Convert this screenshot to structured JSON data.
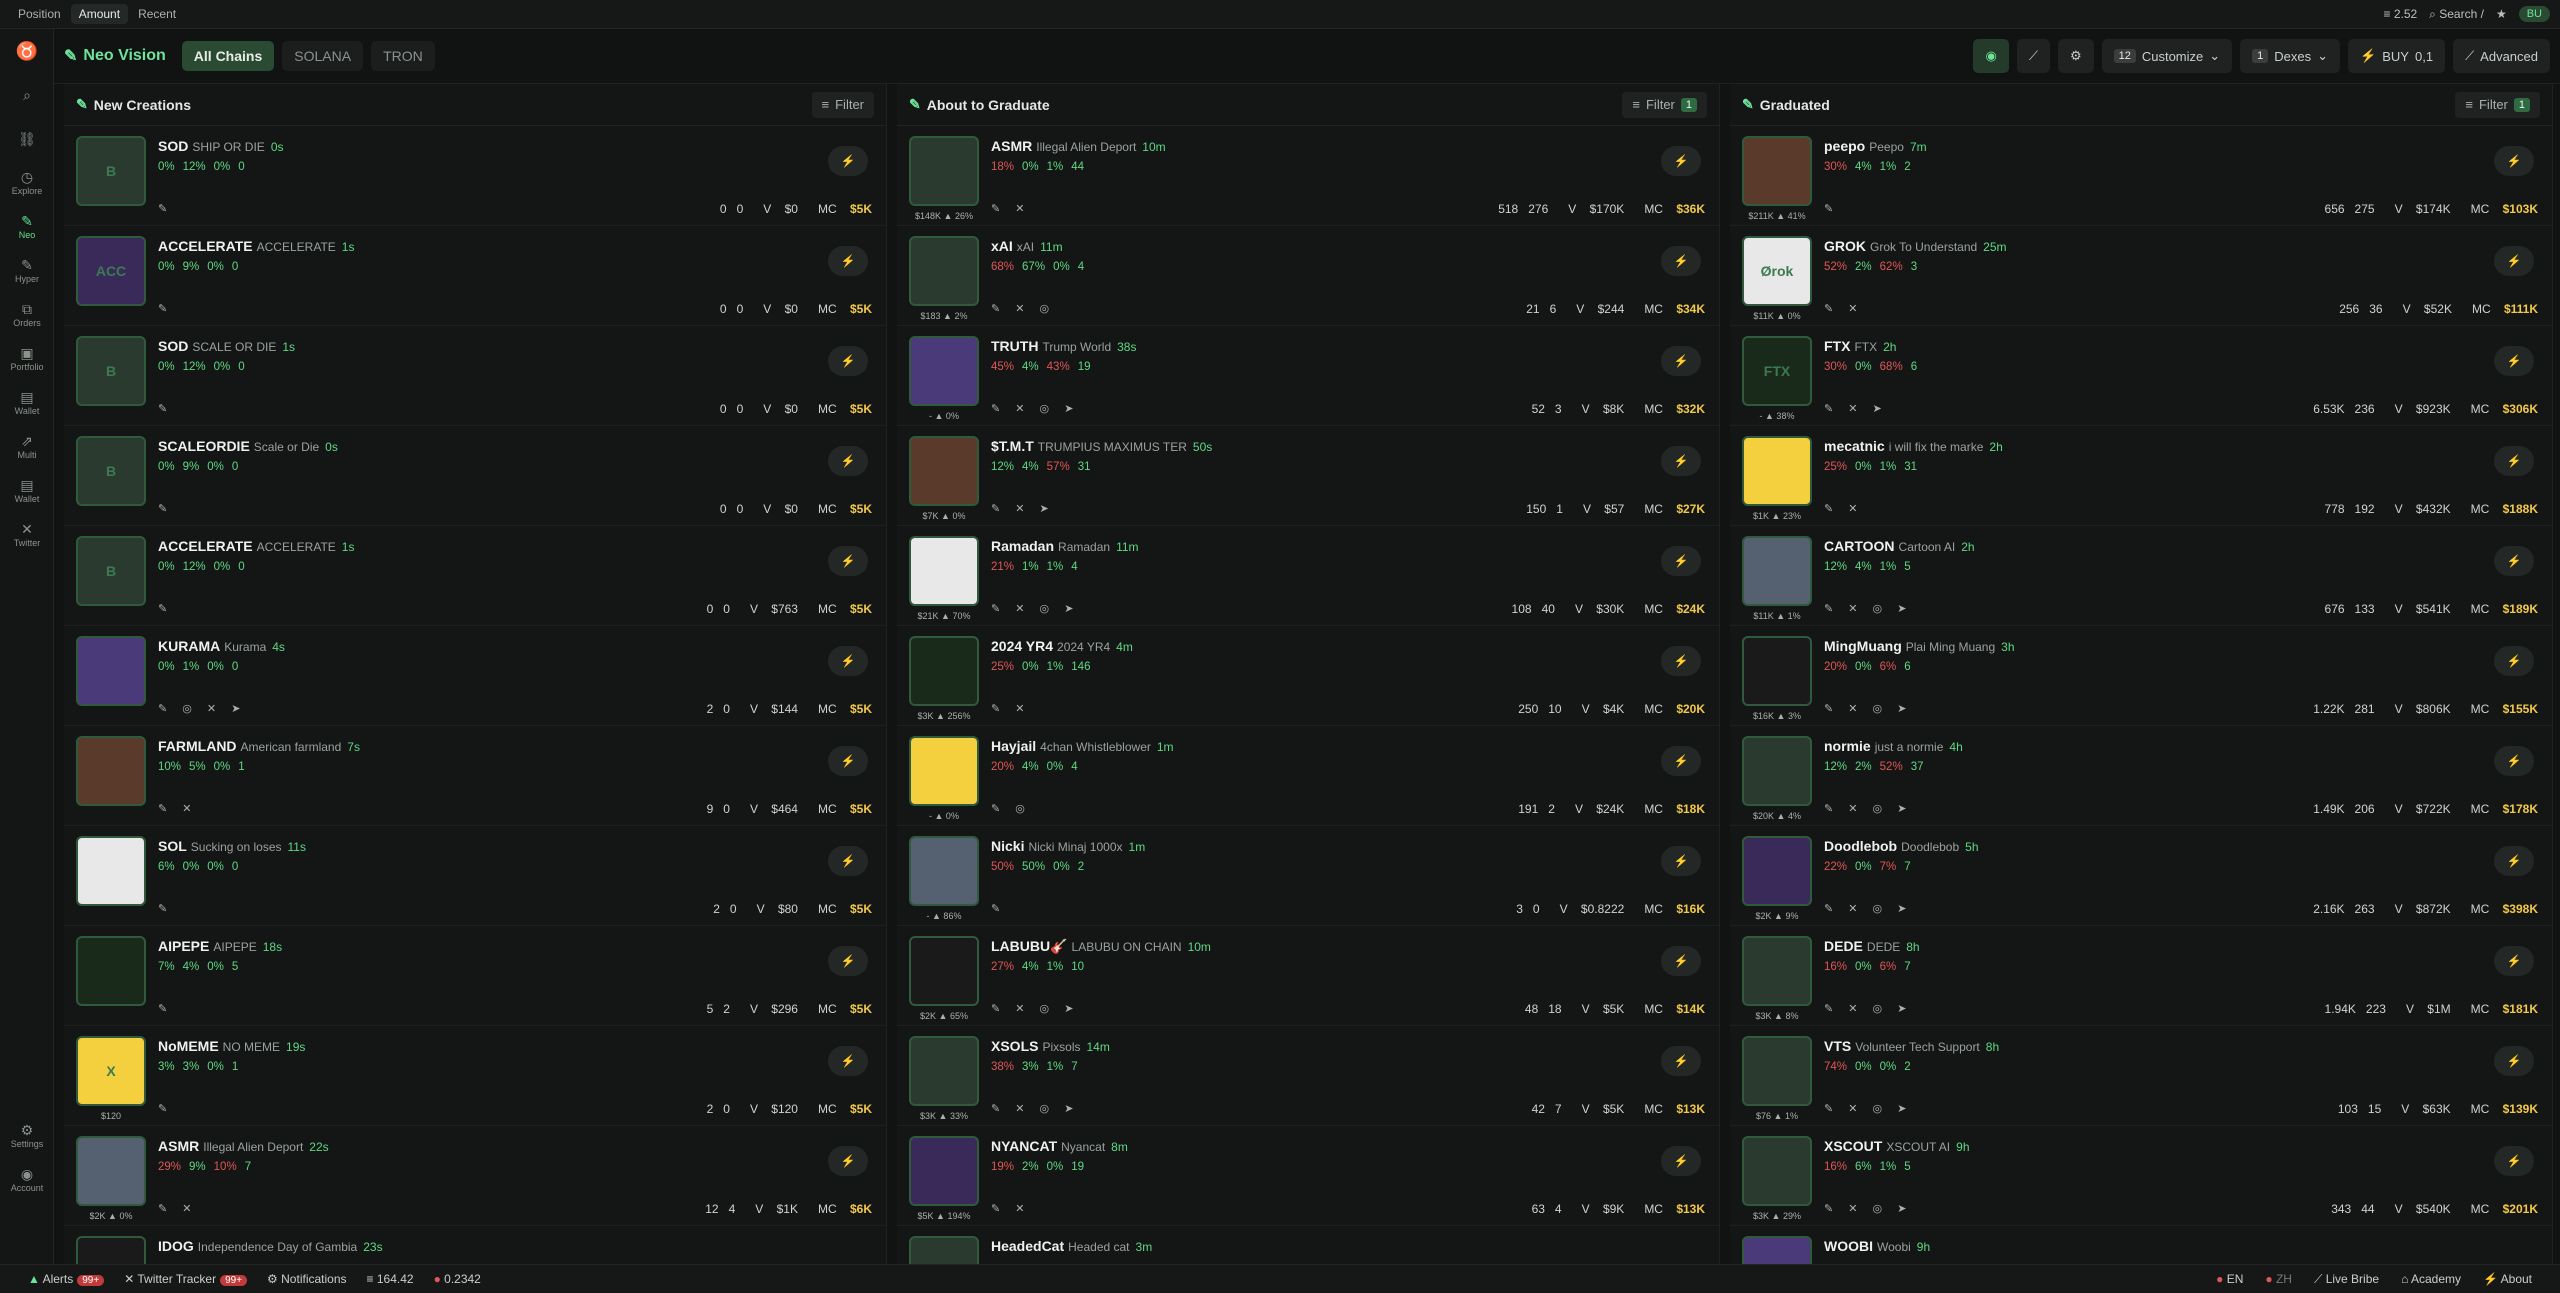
{
  "topbar": {
    "tabs": [
      "Position",
      "Amount",
      "Recent"
    ],
    "active": "Amount",
    "balance": "2.52",
    "search": "Search",
    "search_key": "/",
    "user": "BU"
  },
  "sidebar": [
    "Explore",
    "Neo",
    "Hyper",
    "Orders",
    "Portfolio",
    "Wallet",
    "Multi",
    "Wallet",
    "Twitter"
  ],
  "sidebar_bottom": [
    "Settings",
    "Account"
  ],
  "brand": "Neo Vision",
  "chains": [
    "All Chains",
    "SOLANA",
    "TRON"
  ],
  "header": {
    "customize_count": "12",
    "customize": "Customize",
    "dexes_count": "1",
    "dexes": "Dexes",
    "buy": "BUY",
    "buy_amount": "0,1",
    "advanced": "Advanced"
  },
  "columns": [
    {
      "title": "New Creations",
      "filter": "Filter",
      "filter_count": "",
      "rows": [
        {
          "sym": "SOD",
          "name": "SHIP OR DIE",
          "age": "0s",
          "s": [
            "0%",
            "12%",
            "0%",
            "0"
          ],
          "icons": "✎",
          "h": "0",
          "b": "0",
          "v": "$0",
          "mc": "$5K",
          "av": "B",
          "lbl": ""
        },
        {
          "sym": "ACCELERATE",
          "name": "ACCELERATE",
          "age": "1s",
          "s": [
            "0%",
            "9%",
            "0%",
            "0"
          ],
          "icons": "✎",
          "h": "0",
          "b": "0",
          "v": "$0",
          "mc": "$5K",
          "av": "ACC",
          "lbl": ""
        },
        {
          "sym": "SOD",
          "name": "SCALE OR DIE",
          "age": "1s",
          "s": [
            "0%",
            "12%",
            "0%",
            "0"
          ],
          "icons": "✎",
          "h": "0",
          "b": "0",
          "v": "$0",
          "mc": "$5K",
          "av": "B",
          "lbl": ""
        },
        {
          "sym": "SCALEORDIE",
          "name": "Scale or Die",
          "age": "0s",
          "s": [
            "0%",
            "9%",
            "0%",
            "0"
          ],
          "icons": "✎",
          "h": "0",
          "b": "0",
          "v": "$0",
          "mc": "$5K",
          "av": "B",
          "lbl": ""
        },
        {
          "sym": "ACCELERATE",
          "name": "ACCELERATE",
          "age": "1s",
          "s": [
            "0%",
            "12%",
            "0%",
            "0"
          ],
          "icons": "✎",
          "h": "0",
          "b": "0",
          "v": "$763",
          "mc": "$5K",
          "av": "B",
          "lbl": ""
        },
        {
          "sym": "KURAMA",
          "name": "Kurama",
          "age": "4s",
          "s": [
            "0%",
            "1%",
            "0%",
            "0"
          ],
          "icons": "✎ ◎ ✕ ➤",
          "h": "2",
          "b": "0",
          "v": "$144",
          "mc": "$5K",
          "av": "",
          "lbl": ""
        },
        {
          "sym": "FARMLAND",
          "name": "American farmland",
          "age": "7s",
          "s": [
            "10%",
            "5%",
            "0%",
            "1"
          ],
          "icons": "✎ ✕",
          "h": "9",
          "b": "0",
          "v": "$464",
          "mc": "$5K",
          "av": "",
          "lbl": ""
        },
        {
          "sym": "SOL",
          "name": "Sucking on loses",
          "age": "11s",
          "s": [
            "6%",
            "0%",
            "0%",
            "0"
          ],
          "icons": "✎",
          "h": "2",
          "b": "0",
          "v": "$80",
          "mc": "$5K",
          "av": "",
          "lbl": ""
        },
        {
          "sym": "AIPEPE",
          "name": "AIPEPE",
          "age": "18s",
          "s": [
            "7%",
            "4%",
            "0%",
            "5"
          ],
          "icons": "✎",
          "h": "5",
          "b": "2",
          "v": "$296",
          "mc": "$5K",
          "av": "",
          "lbl": ""
        },
        {
          "sym": "NoMEME",
          "name": "NO MEME",
          "age": "19s",
          "s": [
            "3%",
            "3%",
            "0%",
            "1"
          ],
          "icons": "✎",
          "h": "2",
          "b": "0",
          "v": "$120",
          "mc": "$5K",
          "av": "X",
          "lbl": "$120"
        },
        {
          "sym": "ASMR",
          "name": "Illegal Alien Deport",
          "age": "22s",
          "s": [
            "29%",
            "9%",
            "10%",
            "7"
          ],
          "icons": "✎ ✕",
          "h": "12",
          "b": "4",
          "v": "$1K",
          "mc": "$6K",
          "av": "",
          "lbl": "$2K ▲ 0%"
        },
        {
          "sym": "IDOG",
          "name": "Independence Day of Gambia",
          "age": "23s",
          "s": [
            "",
            "",
            "",
            ""
          ],
          "icons": "",
          "h": "",
          "b": "",
          "v": "",
          "mc": "",
          "av": "",
          "lbl": ""
        }
      ]
    },
    {
      "title": "About to Graduate",
      "filter": "Filter",
      "filter_count": "1",
      "rows": [
        {
          "sym": "ASMR",
          "name": "Illegal Alien Deport",
          "age": "10m",
          "s": [
            "18%",
            "0%",
            "1%",
            "44"
          ],
          "icons": "✎ ✕",
          "h": "518",
          "b": "276",
          "v": "$170K",
          "mc": "$36K",
          "av": "",
          "lbl": "$148K ▲ 26%"
        },
        {
          "sym": "xAI",
          "name": "xAI",
          "age": "11m",
          "s": [
            "68%",
            "67%",
            "0%",
            "4"
          ],
          "icons": "✎ ✕ ◎",
          "h": "21",
          "b": "6",
          "v": "$244",
          "mc": "$34K",
          "av": "",
          "lbl": "$183 ▲ 2%"
        },
        {
          "sym": "TRUTH",
          "name": "Trump World",
          "age": "38s",
          "s": [
            "45%",
            "4%",
            "43%",
            "19"
          ],
          "icons": "✎ ✕ ◎ ➤",
          "h": "52",
          "b": "3",
          "v": "$8K",
          "mc": "$32K",
          "av": "",
          "lbl": "- ▲ 0%"
        },
        {
          "sym": "$T.M.T",
          "name": "TRUMPIUS MAXIMUS TER",
          "age": "50s",
          "s": [
            "12%",
            "4%",
            "57%",
            "31"
          ],
          "icons": "✎ ✕ ➤",
          "h": "150",
          "b": "1",
          "v": "$57",
          "mc": "$27K",
          "av": "",
          "lbl": "$7K ▲ 0%"
        },
        {
          "sym": "Ramadan",
          "name": "Ramadan",
          "age": "11m",
          "s": [
            "21%",
            "1%",
            "1%",
            "4"
          ],
          "icons": "✎ ✕ ◎ ➤",
          "h": "108",
          "b": "40",
          "v": "$30K",
          "mc": "$24K",
          "av": "",
          "lbl": "$21K ▲ 70%"
        },
        {
          "sym": "2024 YR4",
          "name": "2024 YR4",
          "age": "4m",
          "s": [
            "25%",
            "0%",
            "1%",
            "146"
          ],
          "icons": "✎ ✕",
          "h": "250",
          "b": "10",
          "v": "$4K",
          "mc": "$20K",
          "av": "",
          "lbl": "$3K ▲ 256%"
        },
        {
          "sym": "Hayjail",
          "name": "4chan Whistleblower",
          "age": "1m",
          "s": [
            "20%",
            "4%",
            "0%",
            "4"
          ],
          "icons": "✎ ◎",
          "h": "191",
          "b": "2",
          "v": "$24K",
          "mc": "$18K",
          "av": "",
          "lbl": "- ▲ 0%"
        },
        {
          "sym": "Nicki",
          "name": "Nicki Minaj 1000x",
          "age": "1m",
          "s": [
            "50%",
            "50%",
            "0%",
            "2"
          ],
          "icons": "✎",
          "h": "3",
          "b": "0",
          "v": "$0.8222",
          "mc": "$16K",
          "av": "",
          "lbl": "- ▲ 86%"
        },
        {
          "sym": "LABUBU🎸",
          "name": "LABUBU ON CHAIN",
          "age": "10m",
          "s": [
            "27%",
            "4%",
            "1%",
            "10"
          ],
          "icons": "✎ ✕ ◎ ➤",
          "h": "48",
          "b": "18",
          "v": "$5K",
          "mc": "$14K",
          "av": "",
          "lbl": "$2K ▲ 65%"
        },
        {
          "sym": "XSOLS",
          "name": "Pixsols",
          "age": "14m",
          "s": [
            "38%",
            "3%",
            "1%",
            "7"
          ],
          "icons": "✎ ✕ ◎ ➤",
          "h": "42",
          "b": "7",
          "v": "$5K",
          "mc": "$13K",
          "av": "",
          "lbl": "$3K ▲ 33%"
        },
        {
          "sym": "NYANCAT",
          "name": "Nyancat",
          "age": "8m",
          "s": [
            "19%",
            "2%",
            "0%",
            "19"
          ],
          "icons": "✎ ✕",
          "h": "63",
          "b": "4",
          "v": "$9K",
          "mc": "$13K",
          "av": "",
          "lbl": "$5K ▲ 194%"
        },
        {
          "sym": "HeadedCat",
          "name": "Headed cat",
          "age": "3m",
          "s": [
            "",
            "",
            "",
            ""
          ],
          "icons": "",
          "h": "",
          "b": "",
          "v": "",
          "mc": "",
          "av": "",
          "lbl": ""
        }
      ]
    },
    {
      "title": "Graduated",
      "filter": "Filter",
      "filter_count": "1",
      "rows": [
        {
          "sym": "peepo",
          "name": "Peepo",
          "age": "7m",
          "s": [
            "30%",
            "4%",
            "1%",
            "2"
          ],
          "icons": "✎",
          "h": "656",
          "b": "275",
          "v": "$174K",
          "mc": "$103K",
          "av": "",
          "lbl": "$211K ▲ 41%"
        },
        {
          "sym": "GROK",
          "name": "Grok To Understand",
          "age": "25m",
          "s": [
            "52%",
            "2%",
            "62%",
            "3"
          ],
          "icons": "✎ ✕",
          "h": "256",
          "b": "36",
          "v": "$52K",
          "mc": "$111K",
          "av": "Ørok",
          "lbl": "$11K ▲ 0%"
        },
        {
          "sym": "FTX",
          "name": "FTX",
          "age": "2h",
          "s": [
            "30%",
            "0%",
            "68%",
            "6"
          ],
          "icons": "✎ ✕ ➤",
          "h": "6.53K",
          "b": "236",
          "v": "$923K",
          "mc": "$306K",
          "av": "FTX",
          "lbl": "- ▲ 38%"
        },
        {
          "sym": "mecatnic",
          "name": "i will fix the marke",
          "age": "2h",
          "s": [
            "25%",
            "0%",
            "1%",
            "31"
          ],
          "icons": "✎ ✕",
          "h": "778",
          "b": "192",
          "v": "$432K",
          "mc": "$188K",
          "av": "",
          "lbl": "$1K ▲ 23%"
        },
        {
          "sym": "CARTOON",
          "name": "Cartoon AI",
          "age": "2h",
          "s": [
            "12%",
            "4%",
            "1%",
            "5"
          ],
          "icons": "✎ ✕ ◎ ➤",
          "h": "676",
          "b": "133",
          "v": "$541K",
          "mc": "$189K",
          "av": "",
          "lbl": "$11K ▲ 1%"
        },
        {
          "sym": "MingMuang",
          "name": "Plai Ming Muang",
          "age": "3h",
          "s": [
            "20%",
            "0%",
            "6%",
            "6"
          ],
          "icons": "✎ ✕ ◎ ➤",
          "h": "1.22K",
          "b": "281",
          "v": "$806K",
          "mc": "$155K",
          "av": "",
          "lbl": "$16K ▲ 3%"
        },
        {
          "sym": "normie",
          "name": "just a normie",
          "age": "4h",
          "s": [
            "12%",
            "2%",
            "52%",
            "37"
          ],
          "icons": "✎ ✕ ◎ ➤",
          "h": "1.49K",
          "b": "206",
          "v": "$722K",
          "mc": "$178K",
          "av": "",
          "lbl": "$20K ▲ 4%"
        },
        {
          "sym": "Doodlebob",
          "name": "Doodlebob",
          "age": "5h",
          "s": [
            "22%",
            "0%",
            "7%",
            "7"
          ],
          "icons": "✎ ✕ ◎ ➤",
          "h": "2.16K",
          "b": "263",
          "v": "$872K",
          "mc": "$398K",
          "av": "",
          "lbl": "$2K ▲ 9%"
        },
        {
          "sym": "DEDE",
          "name": "DEDE",
          "age": "8h",
          "s": [
            "16%",
            "0%",
            "6%",
            "7"
          ],
          "icons": "✎ ✕ ◎ ➤",
          "h": "1.94K",
          "b": "223",
          "v": "$1M",
          "mc": "$181K",
          "av": "",
          "lbl": "$3K ▲ 8%"
        },
        {
          "sym": "VTS",
          "name": "Volunteer Tech Support",
          "age": "8h",
          "s": [
            "74%",
            "0%",
            "0%",
            "2"
          ],
          "icons": "✎ ✕ ◎ ➤",
          "h": "103",
          "b": "15",
          "v": "$63K",
          "mc": "$139K",
          "av": "",
          "lbl": "$76 ▲ 1%"
        },
        {
          "sym": "XSCOUT",
          "name": "XSCOUT AI",
          "age": "9h",
          "s": [
            "16%",
            "6%",
            "1%",
            "5"
          ],
          "icons": "✎ ✕ ◎ ➤",
          "h": "343",
          "b": "44",
          "v": "$540K",
          "mc": "$201K",
          "av": "",
          "lbl": "$3K ▲ 29%"
        },
        {
          "sym": "WOOBI",
          "name": "Woobi",
          "age": "9h",
          "s": [
            "",
            "",
            "",
            ""
          ],
          "icons": "",
          "h": "",
          "b": "",
          "v": "",
          "mc": "",
          "av": "",
          "lbl": ""
        }
      ]
    }
  ],
  "footer": {
    "alerts": "Alerts",
    "alerts_count": "99+",
    "twitter": "Twitter Tracker",
    "twitter_count": "99+",
    "notifications": "Notifications",
    "sol": "164.42",
    "tron": "0.2342",
    "lang": "EN",
    "lang2": "ZH",
    "live": "Live Bribe",
    "academy": "Academy",
    "about": "About"
  }
}
